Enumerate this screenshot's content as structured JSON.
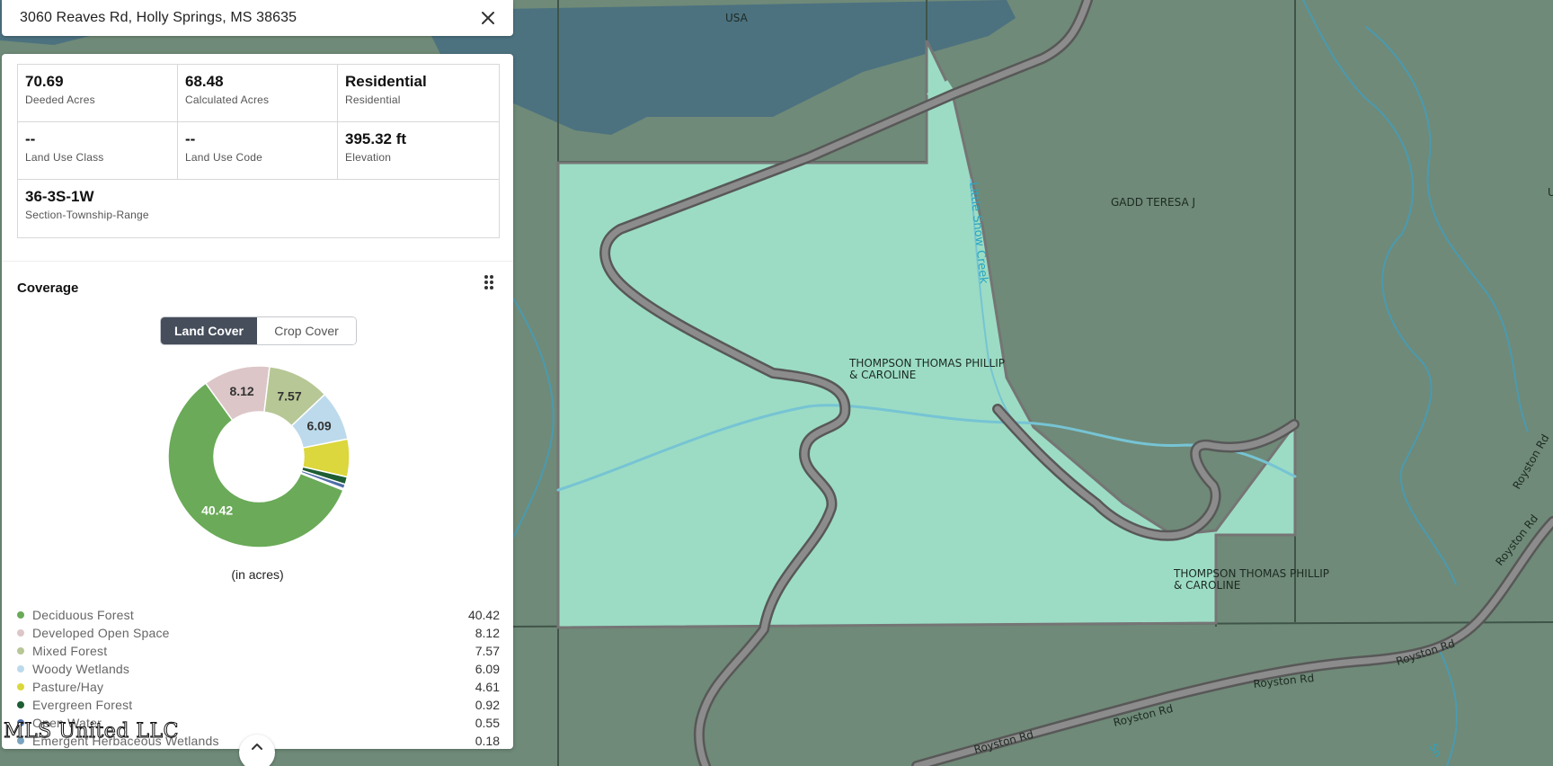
{
  "search": {
    "address": "3060 Reaves Rd, Holly Springs, MS 38635"
  },
  "property": {
    "deeded_acres": {
      "value": "70.69",
      "label": "Deeded Acres"
    },
    "calculated_acres": {
      "value": "68.48",
      "label": "Calculated Acres"
    },
    "zoning": {
      "value": "Residential",
      "label": "Residential"
    },
    "land_use_class": {
      "value": "--",
      "label": "Land Use Class"
    },
    "land_use_code": {
      "value": "--",
      "label": "Land Use Code"
    },
    "elevation": {
      "value": "395.32 ft",
      "label": "Elevation"
    },
    "str": {
      "value": "36-3S-1W",
      "label": "Section-Township-Range"
    }
  },
  "coverage": {
    "title": "Coverage",
    "tabs": {
      "active": "Land Cover",
      "inactive": "Crop Cover"
    },
    "units": "(in acres)",
    "items": [
      {
        "name": "Deciduous Forest",
        "value": 40.42,
        "display": "40.42",
        "color": "#6aaa58"
      },
      {
        "name": "Developed Open Space",
        "value": 8.12,
        "display": "8.12",
        "color": "#dcc6c8"
      },
      {
        "name": "Mixed Forest",
        "value": 7.57,
        "display": "7.57",
        "color": "#b7c795"
      },
      {
        "name": "Woody Wetlands",
        "value": 6.09,
        "display": "6.09",
        "color": "#bcdaeb"
      },
      {
        "name": "Pasture/Hay",
        "value": 4.61,
        "display": "4.61",
        "color": "#dbd73c"
      },
      {
        "name": "Evergreen Forest",
        "value": 0.92,
        "display": "0.92",
        "color": "#1e5e34"
      },
      {
        "name": "Open Water",
        "value": 0.55,
        "display": "0.55",
        "color": "#4f6fa6"
      },
      {
        "name": "Emergent Herbaceous Wetlands",
        "value": 0.18,
        "display": "0.18",
        "color": "#7aa4bf"
      }
    ]
  },
  "map": {
    "labels": {
      "usa": "USA",
      "owner_north": "GADD TERESA J",
      "owner_parcel_1": "THOMPSON THOMAS PHILLIP",
      "owner_parcel_2": "& CAROLINE",
      "owner_south_1": "THOMPSON THOMAS PHILLIP",
      "owner_south_2": "& CAROLINE",
      "creek": "Little Snow Creek",
      "road_1": "Royston Rd",
      "road_2": "Royston Rd",
      "road_3": "Royston Rd",
      "road_4": "Royston Rd",
      "road_5": "Royston Rd",
      "road_6": "Royston Rd",
      "edge_1": "U",
      "edge_2": "Sn"
    }
  },
  "watermark": "MLS United LLC"
}
